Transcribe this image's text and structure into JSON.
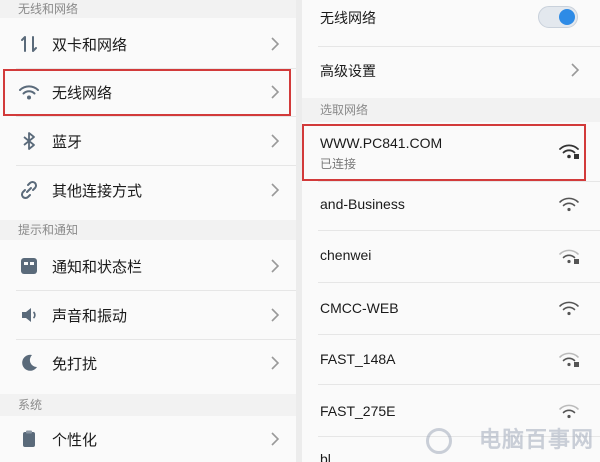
{
  "left": {
    "section1_header": "无线和网络",
    "items1": [
      {
        "label": "双卡和网络",
        "icon": "sim-transfer-icon"
      },
      {
        "label": "无线网络",
        "icon": "wifi-icon"
      },
      {
        "label": "蓝牙",
        "icon": "bluetooth-icon"
      },
      {
        "label": "其他连接方式",
        "icon": "link-icon"
      }
    ],
    "section2_header": "提示和通知",
    "items2": [
      {
        "label": "通知和状态栏",
        "icon": "notification-icon"
      },
      {
        "label": "声音和振动",
        "icon": "speaker-icon"
      },
      {
        "label": "免打扰",
        "icon": "moon-icon"
      }
    ],
    "section3_header": "系统",
    "items3": [
      {
        "label": "个性化",
        "icon": "clipboard-icon"
      }
    ]
  },
  "right": {
    "wifi_toggle_label": "无线网络",
    "wifi_toggle_on": true,
    "advanced_label": "高级设置",
    "networks_header": "选取网络",
    "connected": {
      "ssid": "WWW.PC841.COM",
      "status": "已连接"
    },
    "networks": [
      {
        "ssid": "and-Business",
        "secured": false
      },
      {
        "ssid": "chenwei",
        "secured": true
      },
      {
        "ssid": "CMCC-WEB",
        "secured": false
      },
      {
        "ssid": "FAST_148A",
        "secured": true
      },
      {
        "ssid": "FAST_275E",
        "secured": false
      }
    ],
    "partial_label": "bl"
  },
  "watermark": "电脑百事网",
  "colors": {
    "accent": "#2e8be6",
    "highlight": "#d23a3a"
  }
}
